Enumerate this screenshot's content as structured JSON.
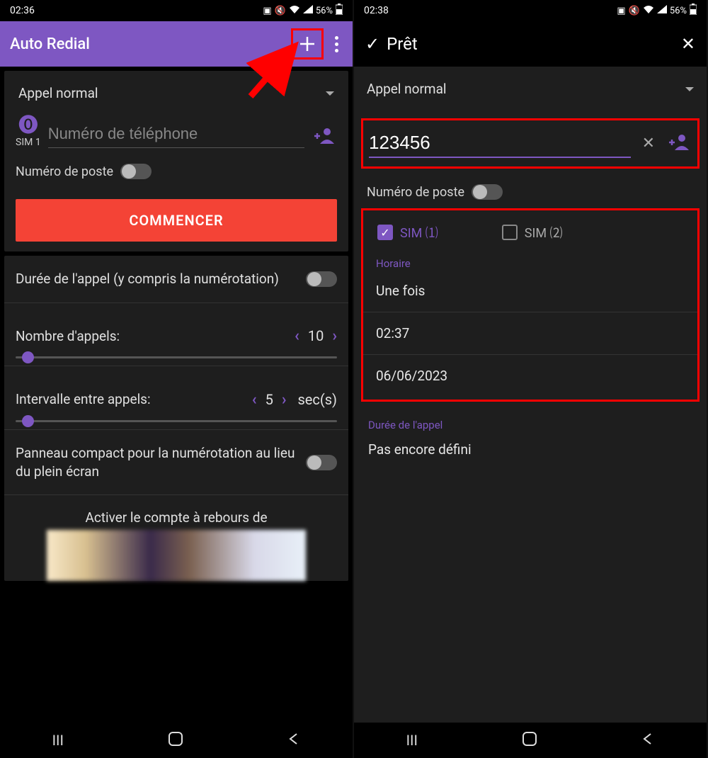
{
  "left": {
    "status": {
      "time": "02:36",
      "battery": "56%"
    },
    "appbar": {
      "title": "Auto Redial"
    },
    "dropdown": "Appel normal",
    "sim_label": "SIM 1",
    "phone_placeholder": "Numéro de téléphone",
    "ext_label": "Numéro de poste",
    "start_button": "COMMENCER",
    "settings": {
      "duration": "Durée de l'appel (y compris la numérotation)",
      "calls_label": "Nombre d'appels:",
      "calls_value": "10",
      "interval_label": "Intervalle entre appels:",
      "interval_value": "5",
      "interval_unit": "sec(s)",
      "compact": "Panneau compact pour la numérotation au lieu du plein écran",
      "countdown": "Activer le compte à rebours de"
    }
  },
  "right": {
    "status": {
      "time": "02:38",
      "battery": "56%"
    },
    "header": {
      "title": "Prêt"
    },
    "dropdown": "Appel normal",
    "phone_value": "123456",
    "ext_label": "Numéro de poste",
    "sim1": "SIM ⑴",
    "sim2": "SIM ⑵",
    "schedule_label": "Horaire",
    "schedule": {
      "mode": "Une fois",
      "time": "02:37",
      "date": "06/06/2023"
    },
    "duration_label": "Durée de l'appel",
    "duration_value": "Pas encore défini"
  }
}
